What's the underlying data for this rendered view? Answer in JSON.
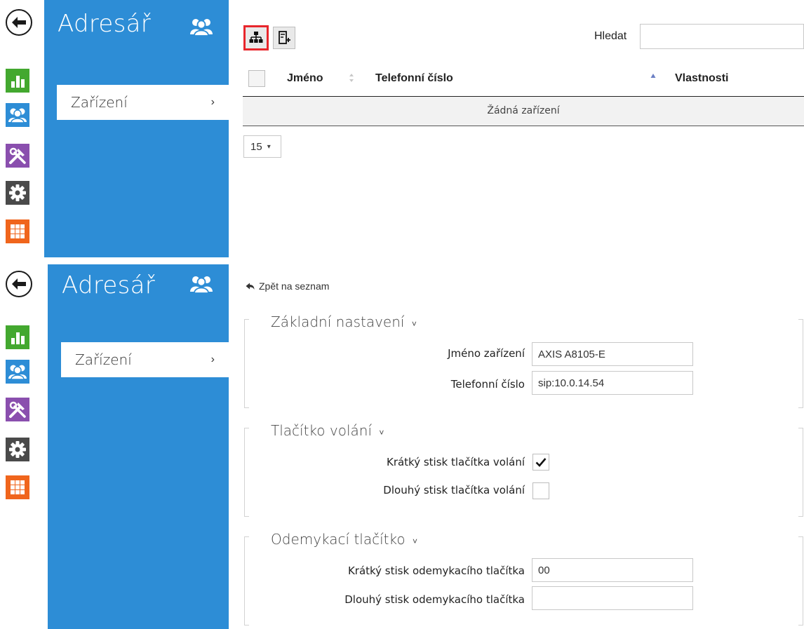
{
  "app": {
    "section_title": "Adresář",
    "nav_item": "Zařízení",
    "nav_chevron": "›"
  },
  "rail_icons": [
    "back-arrow-icon",
    "bar-chart-icon",
    "users-icon",
    "tools-icon",
    "gear-icon",
    "grid-icon"
  ],
  "list_view": {
    "search_label": "Hledat",
    "search_value": "",
    "columns": [
      "Jméno",
      "Telefonní číslo",
      "Vlastnosti"
    ],
    "empty_text": "Žádná zařízení",
    "page_size": "15",
    "page_size_caret": "▾",
    "sort_asc": "▲",
    "sort_both": "⬍"
  },
  "detail_view": {
    "back_label": "Zpět na seznam",
    "sections": [
      {
        "title": "Základní nastavení",
        "fields": [
          {
            "label": "Jméno zařízení",
            "value": "AXIS A8105-E"
          },
          {
            "label": "Telefonní číslo",
            "value": "sip:10.0.14.54"
          }
        ]
      },
      {
        "title": "Tlačítko volání",
        "fields": [
          {
            "label": "Krátký stisk tlačítka volání",
            "checked": true
          },
          {
            "label": "Dlouhý stisk tlačítka volání",
            "checked": false
          }
        ]
      },
      {
        "title": "Odemykací tlačítko",
        "fields": [
          {
            "label": "Krátký stisk odemykacího tlačítka",
            "value": "00"
          },
          {
            "label": "Dlouhý stisk odemykacího tlačítka",
            "value": ""
          }
        ]
      }
    ],
    "section_caret": "˅"
  },
  "colors": {
    "sidebar_blue": "#2d8dd6",
    "stats_green": "#43a82f",
    "tools_purple": "#8a4fae",
    "settings_dark": "#4a4a4a",
    "apps_orange": "#f0651c",
    "highlight_red": "#e8262c"
  }
}
